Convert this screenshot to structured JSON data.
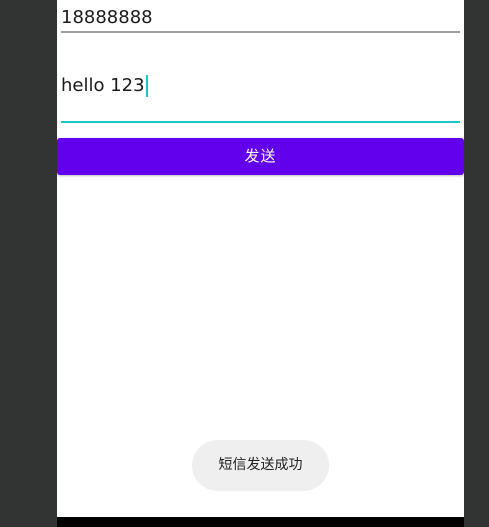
{
  "form": {
    "phone_value": "18888888",
    "message_value": "hello 123",
    "send_label": "发送"
  },
  "toast": {
    "message": "短信发送成功"
  },
  "colors": {
    "accent": "#6200ee",
    "focus_underline": "#1bc6c6",
    "background": "#ffffff",
    "frame": "#323434"
  }
}
